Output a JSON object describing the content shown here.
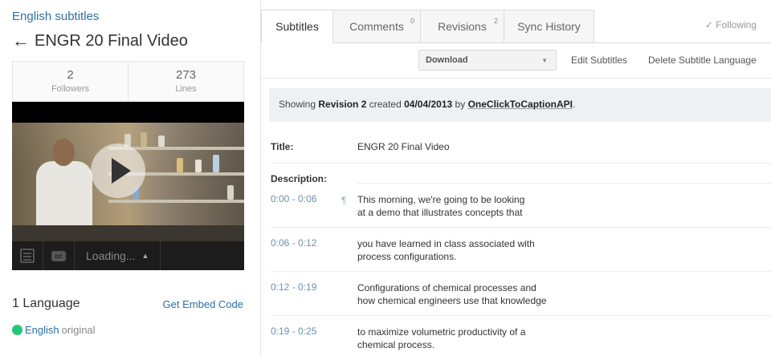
{
  "header": {
    "language_link": "English subtitles",
    "back_arrow": "←",
    "video_title": "ENGR 20 Final Video"
  },
  "stats": [
    {
      "value": "2",
      "label": "Followers"
    },
    {
      "value": "273",
      "label": "Lines"
    }
  ],
  "player": {
    "loading_label": "Loading...",
    "loading_caret": "▲",
    "cc_glyph": "cc"
  },
  "languages": {
    "count_label": "1 Language",
    "embed_link": "Get Embed Code",
    "items": [
      {
        "name": "English",
        "note": "original",
        "status_color": "#22c87a"
      }
    ]
  },
  "tabs": [
    {
      "label": "Subtitles",
      "count": ""
    },
    {
      "label": "Comments",
      "count": "0"
    },
    {
      "label": "Revisions",
      "count": "2"
    },
    {
      "label": "Sync History",
      "count": ""
    }
  ],
  "following_label": "✓ Following",
  "toolbar": {
    "download_label": "Download",
    "download_caret": "▼",
    "edit_label": "Edit Subtitles",
    "delete_label": "Delete Subtitle Language"
  },
  "revision": {
    "prefix": "Showing",
    "revision_name": "Revision 2",
    "created_word": "created",
    "date": "04/04/2013",
    "by_word": "by",
    "author": "OneClickToCaptionAPI",
    "suffix": "."
  },
  "meta": {
    "title_label": "Title:",
    "title_value": "ENGR 20 Final Video",
    "description_label": "Description:"
  },
  "subtitles": [
    {
      "time": "0:00 - 0:06",
      "para": "¶",
      "line1": "This morning, we're going to be looking",
      "line2": "at a demo that illustrates concepts that"
    },
    {
      "time": "0:06 - 0:12",
      "para": "",
      "line1": "you have learned in class associated with",
      "line2": "process configurations."
    },
    {
      "time": "0:12 - 0:19",
      "para": "",
      "line1": "Configurations of chemical processes and",
      "line2": "how chemical engineers use that knowledge"
    },
    {
      "time": "0:19 - 0:25",
      "para": "",
      "line1": "to maximize volumetric productivity of a",
      "line2": "chemical process."
    }
  ],
  "colors": {
    "link": "#2f6fa1",
    "timestamp": "#6d8fb0",
    "status_green": "#22c87a"
  }
}
